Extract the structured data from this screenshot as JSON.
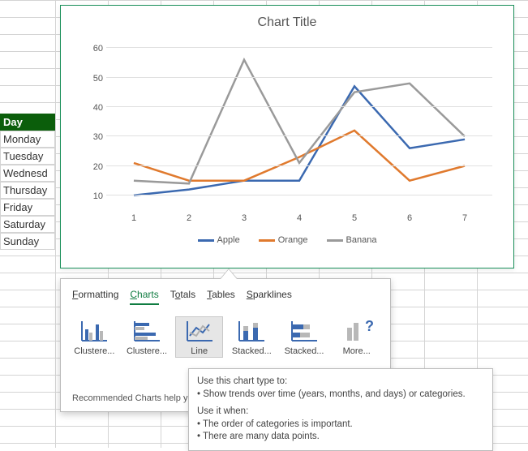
{
  "spreadsheet": {
    "header": "Day",
    "rows": [
      "Monday",
      "Tuesday",
      "Wednesd",
      "Thursday",
      "Friday",
      "Saturday",
      "Sunday"
    ]
  },
  "chart": {
    "title": "Chart Title",
    "legend": [
      "Apple",
      "Orange",
      "Banana"
    ],
    "colors": {
      "Apple": "#3b69b0",
      "Orange": "#e07a2e",
      "Banana": "#9a9a9a"
    },
    "y_ticks": [
      10,
      20,
      30,
      40,
      50,
      60
    ],
    "x_ticks": [
      1,
      2,
      3,
      4,
      5,
      6,
      7
    ]
  },
  "chart_data": {
    "type": "line",
    "title": "Chart Title",
    "xlabel": "",
    "ylabel": "",
    "ylim": [
      5,
      65
    ],
    "categories": [
      1,
      2,
      3,
      4,
      5,
      6,
      7
    ],
    "series": [
      {
        "name": "Apple",
        "values": [
          10,
          12,
          15,
          15,
          47,
          26,
          29
        ]
      },
      {
        "name": "Orange",
        "values": [
          21,
          15,
          15,
          23,
          32,
          15,
          20
        ]
      },
      {
        "name": "Banana",
        "values": [
          15,
          14,
          56,
          21,
          45,
          48,
          30
        ]
      }
    ]
  },
  "quick_analysis": {
    "tabs": [
      {
        "key": "formatting",
        "label": "Formatting",
        "accel": "F"
      },
      {
        "key": "charts",
        "label": "Charts",
        "accel": "C",
        "selected": true
      },
      {
        "key": "totals",
        "label": "Totals",
        "accel": "O"
      },
      {
        "key": "tables",
        "label": "Tables",
        "accel": "T"
      },
      {
        "key": "sparklines",
        "label": "Sparklines",
        "accel": "S"
      }
    ],
    "items": [
      {
        "key": "clustered-column",
        "label": "Clustere..."
      },
      {
        "key": "clustered-bar",
        "label": "Clustere..."
      },
      {
        "key": "line",
        "label": "Line",
        "selected": true
      },
      {
        "key": "stacked-column",
        "label": "Stacked..."
      },
      {
        "key": "stacked-bar",
        "label": "Stacked..."
      },
      {
        "key": "more",
        "label": "More..."
      }
    ],
    "footer": "Recommended Charts help yo"
  },
  "tooltip": {
    "heading": "Use this chart type to:",
    "bullet1": "Show trends over time (years, months, and days) or categories.",
    "heading2": "Use it when:",
    "bullet2": "The order of categories is important.",
    "bullet3": "There are many data points."
  }
}
